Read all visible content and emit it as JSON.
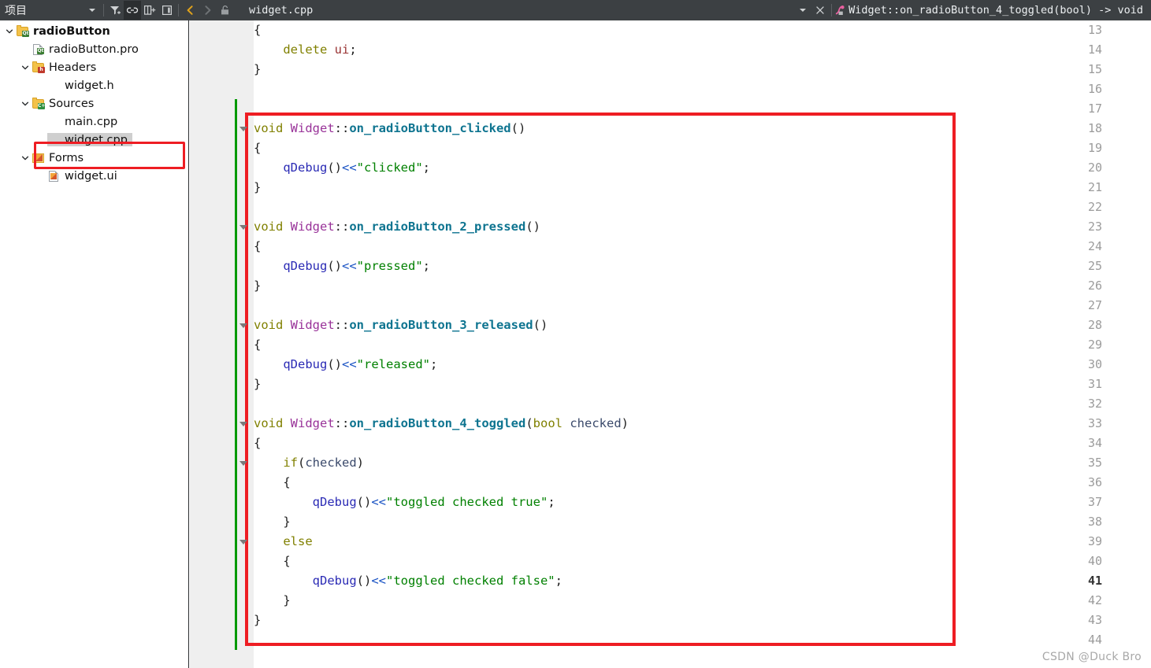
{
  "toolbar": {
    "title": "项目",
    "dropdown_icon": "chevron-down-icon",
    "filter_icon": "filter-icon",
    "link_icon": "link-icon",
    "split_icon": "split-window-icon",
    "sidebar_icon": "toggle-sidebar-icon",
    "back_icon": "navigate-back-icon",
    "forward_icon": "navigate-forward-icon",
    "lock_icon": "unlock-icon",
    "filename": "widget.cpp",
    "file_dropdown_icon": "chevron-down-icon",
    "close_icon": "close-file-icon",
    "symbol_icon": "function-symbol-icon",
    "symbol": "Widget::on_radioButton_4_toggled(bool) -> void"
  },
  "sidebar": {
    "items": [
      {
        "label": "radioButton",
        "icon": "folder-qt-icon",
        "indent": 0,
        "expanded": true,
        "bold": true,
        "selected": false
      },
      {
        "label": "radioButton.pro",
        "icon": "file-qt-pro-icon",
        "indent": 1,
        "expanded": null,
        "bold": false,
        "selected": false
      },
      {
        "label": "Headers",
        "icon": "folder-h-icon",
        "indent": 1,
        "expanded": true,
        "bold": false,
        "selected": false
      },
      {
        "label": "widget.h",
        "icon": "file-plain-icon",
        "indent": 2,
        "expanded": null,
        "bold": false,
        "selected": false
      },
      {
        "label": "Sources",
        "icon": "folder-cpp-icon",
        "indent": 1,
        "expanded": true,
        "bold": false,
        "selected": false
      },
      {
        "label": "main.cpp",
        "icon": "file-plain-icon",
        "indent": 2,
        "expanded": null,
        "bold": false,
        "selected": false
      },
      {
        "label": "widget.cpp",
        "icon": "file-plain-icon",
        "indent": 2,
        "expanded": null,
        "bold": false,
        "selected": true
      },
      {
        "label": "Forms",
        "icon": "folder-form-icon",
        "indent": 1,
        "expanded": true,
        "bold": false,
        "selected": false
      },
      {
        "label": "widget.ui",
        "icon": "file-ui-icon",
        "indent": 2,
        "expanded": null,
        "bold": false,
        "selected": false
      }
    ]
  },
  "editor": {
    "first_line": 13,
    "last_line": 44,
    "current_line": 41,
    "modified_from_line": 17,
    "fold_marker_lines": [
      18,
      23,
      28,
      33,
      35,
      39
    ],
    "lines": [
      {
        "n": 13,
        "tokens": [
          {
            "t": "{",
            "c": "op"
          }
        ]
      },
      {
        "n": 14,
        "tokens": [
          {
            "t": "    ",
            "c": "op"
          },
          {
            "t": "delete",
            "c": "k"
          },
          {
            "t": " ",
            "c": "op"
          },
          {
            "t": "ui",
            "c": "mem"
          },
          {
            "t": ";",
            "c": "op"
          }
        ]
      },
      {
        "n": 15,
        "tokens": [
          {
            "t": "}",
            "c": "op"
          }
        ]
      },
      {
        "n": 16,
        "tokens": []
      },
      {
        "n": 17,
        "tokens": []
      },
      {
        "n": 18,
        "tokens": [
          {
            "t": "void",
            "c": "k"
          },
          {
            "t": " ",
            "c": "op"
          },
          {
            "t": "Widget",
            "c": "cls"
          },
          {
            "t": "::",
            "c": "op"
          },
          {
            "t": "on_radioButton_clicked",
            "c": "fn"
          },
          {
            "t": "()",
            "c": "op"
          }
        ]
      },
      {
        "n": 19,
        "tokens": [
          {
            "t": "{",
            "c": "op"
          }
        ]
      },
      {
        "n": 20,
        "tokens": [
          {
            "t": "    ",
            "c": "op"
          },
          {
            "t": "qDebug",
            "c": "call"
          },
          {
            "t": "()",
            "c": "op"
          },
          {
            "t": "<<",
            "c": "shift"
          },
          {
            "t": "\"clicked\"",
            "c": "str"
          },
          {
            "t": ";",
            "c": "op"
          }
        ]
      },
      {
        "n": 21,
        "tokens": [
          {
            "t": "}",
            "c": "op"
          }
        ]
      },
      {
        "n": 22,
        "tokens": []
      },
      {
        "n": 23,
        "tokens": [
          {
            "t": "void",
            "c": "k"
          },
          {
            "t": " ",
            "c": "op"
          },
          {
            "t": "Widget",
            "c": "cls"
          },
          {
            "t": "::",
            "c": "op"
          },
          {
            "t": "on_radioButton_2_pressed",
            "c": "fn"
          },
          {
            "t": "()",
            "c": "op"
          }
        ]
      },
      {
        "n": 24,
        "tokens": [
          {
            "t": "{",
            "c": "op"
          }
        ]
      },
      {
        "n": 25,
        "tokens": [
          {
            "t": "    ",
            "c": "op"
          },
          {
            "t": "qDebug",
            "c": "call"
          },
          {
            "t": "()",
            "c": "op"
          },
          {
            "t": "<<",
            "c": "shift"
          },
          {
            "t": "\"pressed\"",
            "c": "str"
          },
          {
            "t": ";",
            "c": "op"
          }
        ]
      },
      {
        "n": 26,
        "tokens": [
          {
            "t": "}",
            "c": "op"
          }
        ]
      },
      {
        "n": 27,
        "tokens": []
      },
      {
        "n": 28,
        "tokens": [
          {
            "t": "void",
            "c": "k"
          },
          {
            "t": " ",
            "c": "op"
          },
          {
            "t": "Widget",
            "c": "cls"
          },
          {
            "t": "::",
            "c": "op"
          },
          {
            "t": "on_radioButton_3_released",
            "c": "fn"
          },
          {
            "t": "()",
            "c": "op"
          }
        ]
      },
      {
        "n": 29,
        "tokens": [
          {
            "t": "{",
            "c": "op"
          }
        ]
      },
      {
        "n": 30,
        "tokens": [
          {
            "t": "    ",
            "c": "op"
          },
          {
            "t": "qDebug",
            "c": "call"
          },
          {
            "t": "()",
            "c": "op"
          },
          {
            "t": "<<",
            "c": "shift"
          },
          {
            "t": "\"released\"",
            "c": "str"
          },
          {
            "t": ";",
            "c": "op"
          }
        ]
      },
      {
        "n": 31,
        "tokens": [
          {
            "t": "}",
            "c": "op"
          }
        ]
      },
      {
        "n": 32,
        "tokens": []
      },
      {
        "n": 33,
        "tokens": [
          {
            "t": "void",
            "c": "k"
          },
          {
            "t": " ",
            "c": "op"
          },
          {
            "t": "Widget",
            "c": "cls"
          },
          {
            "t": "::",
            "c": "op"
          },
          {
            "t": "on_radioButton_4_toggled",
            "c": "fn"
          },
          {
            "t": "(",
            "c": "op"
          },
          {
            "t": "bool",
            "c": "k"
          },
          {
            "t": " ",
            "c": "op"
          },
          {
            "t": "checked",
            "c": "var"
          },
          {
            "t": ")",
            "c": "op"
          }
        ]
      },
      {
        "n": 34,
        "tokens": [
          {
            "t": "{",
            "c": "op"
          }
        ]
      },
      {
        "n": 35,
        "tokens": [
          {
            "t": "    ",
            "c": "op"
          },
          {
            "t": "if",
            "c": "k"
          },
          {
            "t": "(",
            "c": "op"
          },
          {
            "t": "checked",
            "c": "var"
          },
          {
            "t": ")",
            "c": "op"
          }
        ]
      },
      {
        "n": 36,
        "tokens": [
          {
            "t": "    {",
            "c": "op"
          }
        ]
      },
      {
        "n": 37,
        "tokens": [
          {
            "t": "        ",
            "c": "op"
          },
          {
            "t": "qDebug",
            "c": "call"
          },
          {
            "t": "()",
            "c": "op"
          },
          {
            "t": "<<",
            "c": "shift"
          },
          {
            "t": "\"toggled checked true\"",
            "c": "str"
          },
          {
            "t": ";",
            "c": "op"
          }
        ]
      },
      {
        "n": 38,
        "tokens": [
          {
            "t": "    }",
            "c": "op"
          }
        ]
      },
      {
        "n": 39,
        "tokens": [
          {
            "t": "    ",
            "c": "op"
          },
          {
            "t": "else",
            "c": "k"
          }
        ]
      },
      {
        "n": 40,
        "tokens": [
          {
            "t": "    {",
            "c": "op"
          }
        ]
      },
      {
        "n": 41,
        "tokens": [
          {
            "t": "        ",
            "c": "op"
          },
          {
            "t": "qDebug",
            "c": "call"
          },
          {
            "t": "()",
            "c": "op"
          },
          {
            "t": "<<",
            "c": "shift"
          },
          {
            "t": "\"toggled checked false\"",
            "c": "str"
          },
          {
            "t": ";",
            "c": "op"
          }
        ]
      },
      {
        "n": 42,
        "tokens": [
          {
            "t": "    }",
            "c": "op"
          }
        ]
      },
      {
        "n": 43,
        "tokens": [
          {
            "t": "}",
            "c": "op"
          }
        ]
      },
      {
        "n": 44,
        "tokens": []
      }
    ]
  },
  "annotations": {
    "highlight_color": "#ee1d23"
  },
  "watermark": "CSDN @Duck Bro"
}
